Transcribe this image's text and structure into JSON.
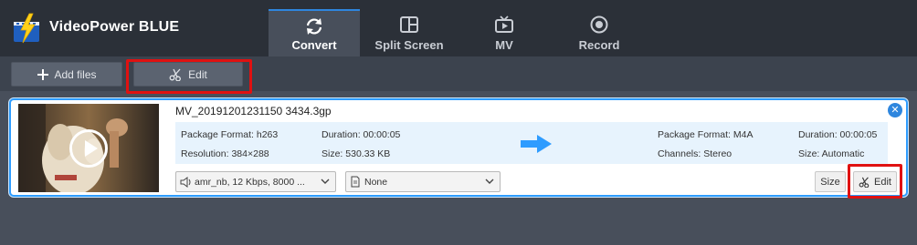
{
  "app": {
    "title": "VideoPower BLUE"
  },
  "tabs": [
    {
      "label": "Convert",
      "icon": "refresh-icon",
      "active": true
    },
    {
      "label": "Split Screen",
      "icon": "split-screen-icon",
      "active": false
    },
    {
      "label": "MV",
      "icon": "tv-icon",
      "active": false
    },
    {
      "label": "Record",
      "icon": "record-icon",
      "active": false
    }
  ],
  "toolbar": {
    "add_files_label": "Add files",
    "edit_label": "Edit"
  },
  "file": {
    "name": "MV_20191201231150 3434.3gp",
    "source": {
      "package_format": "Package Format: h263",
      "duration": "Duration: 00:00:05",
      "resolution": "Resolution: 384×288",
      "size": "Size: 530.33 KB"
    },
    "output": {
      "package_format": "Package Format: M4A",
      "duration": "Duration: 00:00:05",
      "channels": "Channels: Stereo",
      "size": "Size: Automatic"
    },
    "audio_select": "amr_nb, 12 Kbps, 8000 ...",
    "subtitle_select": "None",
    "size_button": "Size",
    "edit_button": "Edit"
  },
  "colors": {
    "accent": "#2e86de",
    "highlight": "#e01111",
    "background": "#484f5b",
    "titlebar": "#2b3038"
  }
}
